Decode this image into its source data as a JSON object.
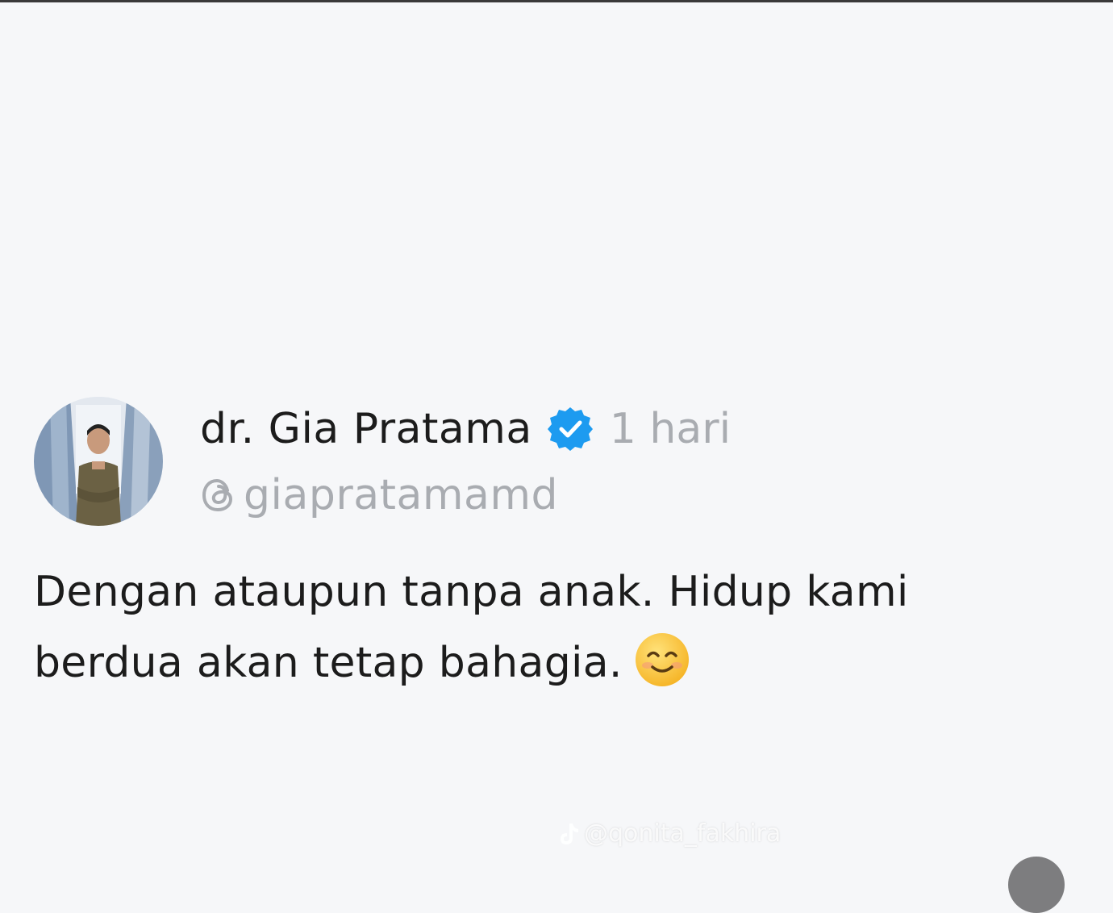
{
  "post": {
    "author_name": "dr. Gia Pratama",
    "time": "1 hari",
    "handle": "giapratamamd",
    "text_line1": "Dengan ataupun tanpa anak.  Hidup kami",
    "text_line2": "berdua akan tetap bahagia.",
    "emoji": "smiling-face-with-smiling-eyes"
  },
  "watermark": {
    "text": "@qonita_fakhira"
  },
  "icons": {
    "verified": "verified-badge-icon",
    "threads": "threads-logo-icon",
    "tiktok": "tiktok-logo-icon"
  },
  "colors": {
    "background": "#f6f7f9",
    "text_primary": "#1c1c1c",
    "text_secondary": "#a9acb1",
    "verified_blue": "#1d9bf0"
  }
}
